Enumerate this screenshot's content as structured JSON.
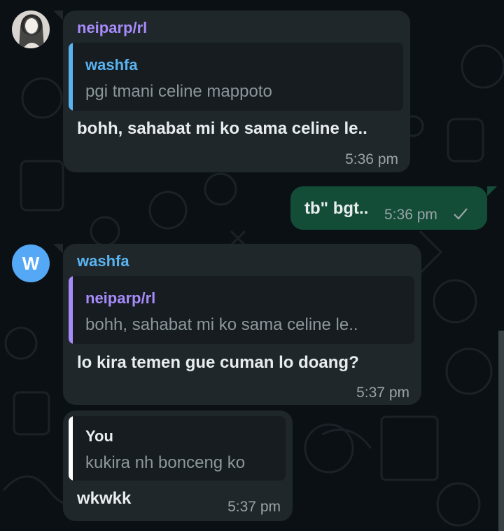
{
  "messages": [
    {
      "sender": "neiparp/rl",
      "reply": {
        "name": "washfa",
        "text": "pgi tmani celine mappoto"
      },
      "text": "bohh, sahabat mi ko sama celine le..",
      "time": "5:36 pm"
    },
    {
      "text": "tb\" bgt..",
      "time": "5:36 pm"
    },
    {
      "avatar_letter": "W",
      "sender": "washfa",
      "reply": {
        "name": "neiparp/rl",
        "text": "bohh, sahabat mi ko sama celine le.."
      },
      "text": "lo kira temen gue cuman lo doang?",
      "time": "5:37 pm"
    },
    {
      "reply": {
        "name": "You",
        "text": "kukira nh bonceng ko"
      },
      "text": "wkwkk",
      "time": "5:37 pm"
    }
  ],
  "colors": {
    "bubble_in": "#1f272a",
    "bubble_out": "#134d37",
    "name_purple": "#a78bfa",
    "name_blue": "#5ab3f0",
    "you_bar": "#ffffff"
  },
  "icons": {
    "sent_tick": "check-icon",
    "photo_avatar": "avatar-photo"
  }
}
